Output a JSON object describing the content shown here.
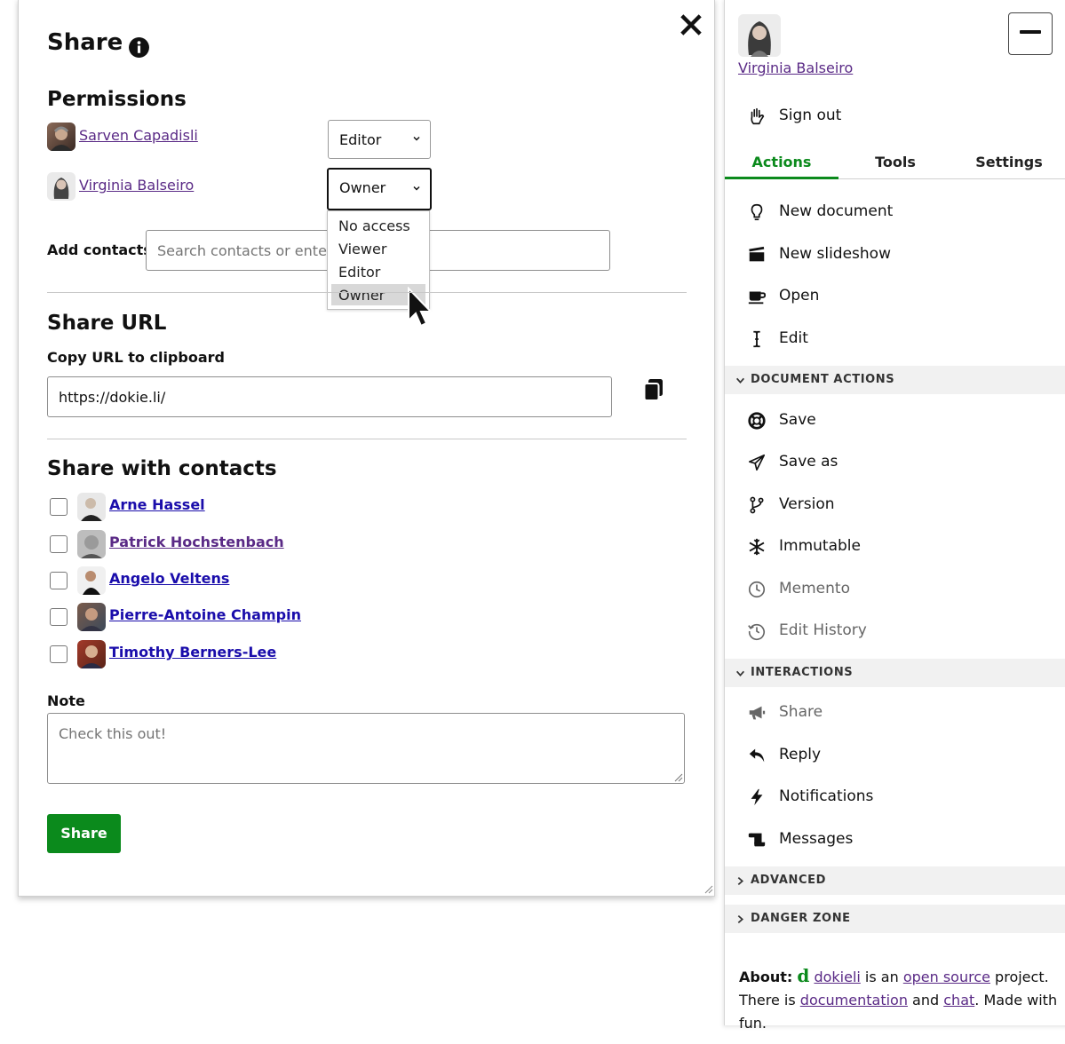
{
  "dialog": {
    "title": "Share",
    "permissions": {
      "heading": "Permissions",
      "people": [
        {
          "name": "Sarven Capadisli",
          "role": "Editor"
        },
        {
          "name": "Virginia Balseiro",
          "role": "Owner"
        }
      ],
      "role_options": [
        "No access",
        "Viewer",
        "Editor",
        "Owner"
      ],
      "selected_option": "Owner",
      "add_contacts_label": "Add contacts",
      "add_contacts_placeholder": "Search contacts or enter W"
    },
    "share_url": {
      "heading": "Share URL",
      "copy_label": "Copy URL to clipboard",
      "url": "https://dokie.li/"
    },
    "share_with_contacts": {
      "heading": "Share with contacts",
      "contacts": [
        {
          "name": "Arne Hassel",
          "checked": false
        },
        {
          "name": "Patrick Hochstenbach",
          "checked": false
        },
        {
          "name": "Angelo Veltens",
          "checked": false
        },
        {
          "name": "Pierre-Antoine Champin",
          "checked": false
        },
        {
          "name": "Timothy Berners-Lee",
          "checked": false
        }
      ]
    },
    "note": {
      "label": "Note",
      "placeholder": "Check this out!"
    },
    "share_button": "Share"
  },
  "sidebar": {
    "user_name": "Virginia Balseiro",
    "sign_out": "Sign out",
    "tabs": [
      "Actions",
      "Tools",
      "Settings"
    ],
    "active_tab": "Actions",
    "actions": [
      {
        "label": "New document",
        "icon": "lightbulb-icon"
      },
      {
        "label": "New slideshow",
        "icon": "clapperboard-icon"
      },
      {
        "label": "Open",
        "icon": "coffee-cup-icon"
      },
      {
        "label": "Edit",
        "icon": "text-cursor-icon"
      }
    ],
    "document_actions": {
      "heading": "DOCUMENT ACTIONS",
      "items": [
        {
          "label": "Save",
          "icon": "life-ring-icon"
        },
        {
          "label": "Save as",
          "icon": "paper-plane-icon"
        },
        {
          "label": "Version",
          "icon": "code-branch-icon"
        },
        {
          "label": "Immutable",
          "icon": "snowflake-icon"
        },
        {
          "label": "Memento",
          "icon": "clock-icon"
        },
        {
          "label": "Edit History",
          "icon": "history-icon"
        }
      ]
    },
    "interactions": {
      "heading": "INTERACTIONS",
      "items": [
        {
          "label": "Share",
          "icon": "bullhorn-icon"
        },
        {
          "label": "Reply",
          "icon": "reply-icon"
        },
        {
          "label": "Notifications",
          "icon": "bolt-icon"
        },
        {
          "label": "Messages",
          "icon": "scroll-icon"
        }
      ]
    },
    "advanced": "ADVANCED",
    "danger_zone": "DANGER ZONE",
    "about": {
      "label": "About:",
      "logo": "d",
      "brand": "dokieli",
      "t1": " is an ",
      "open_source": "open source",
      "t2": " project. There is ",
      "documentation": "documentation",
      "t3": " and ",
      "chat": "chat",
      "t4": ". Made with fun."
    }
  },
  "colors": {
    "accent_green": "#0b8a1c",
    "link_purple": "#5a2a86",
    "link_blue": "#1a0dab"
  }
}
